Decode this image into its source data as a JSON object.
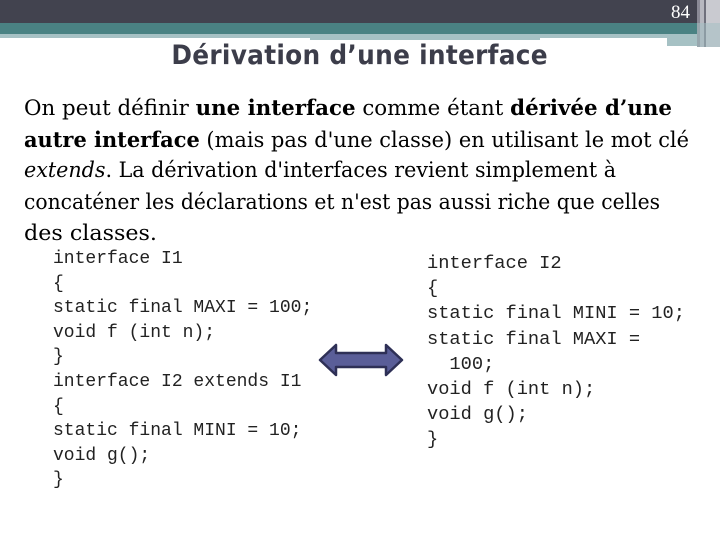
{
  "slide": {
    "number": "84",
    "title": "Dérivation d’une interface"
  },
  "body": {
    "lines": [
      [
        {
          "text": "On peut définir ",
          "style": "normal"
        },
        {
          "text": "une interface",
          "style": "bold"
        },
        {
          "text": " comme étant ",
          "style": "normal"
        },
        {
          "text": "dérivée d’une",
          "style": "bold"
        }
      ],
      [
        {
          "text": "autre interface",
          "style": "bold"
        },
        {
          "text": " (mais pas d'une classe) en utilisant le mot clé",
          "style": "normal"
        }
      ],
      [
        {
          "text": "extends",
          "style": "italic"
        },
        {
          "text": ". La dérivation d'interfaces revient simplement à",
          "style": "normal"
        }
      ],
      [
        {
          "text": "concaténer les déclarations et n'est pas aussi riche que celles",
          "style": "normal"
        }
      ],
      [
        {
          "text": "des classes.",
          "style": "normal"
        }
      ]
    ]
  },
  "code_left": {
    "lines": [
      "interface I1",
      "{",
      "static final MAXI = 100;",
      "void f (int n);",
      "}",
      "interface I2 extends I1",
      "{",
      "static final MINI = 10;",
      "void g();",
      "}"
    ]
  },
  "code_right": {
    "lines": [
      "interface I2",
      "{",
      "static final MINI = 10;",
      "static final MAXI =",
      "  100;",
      "void f (int n);",
      "void g();",
      "}"
    ]
  },
  "arrow": {
    "icon": "double-arrow-icon",
    "meaning": "equivalent",
    "fill": "#5a5e98",
    "stroke": "#2e3056"
  },
  "colors": {
    "header_dark": "#42434f",
    "header_teal": "#4a8283",
    "header_light": "#a6c1c4",
    "title": "#3c3d4a"
  }
}
